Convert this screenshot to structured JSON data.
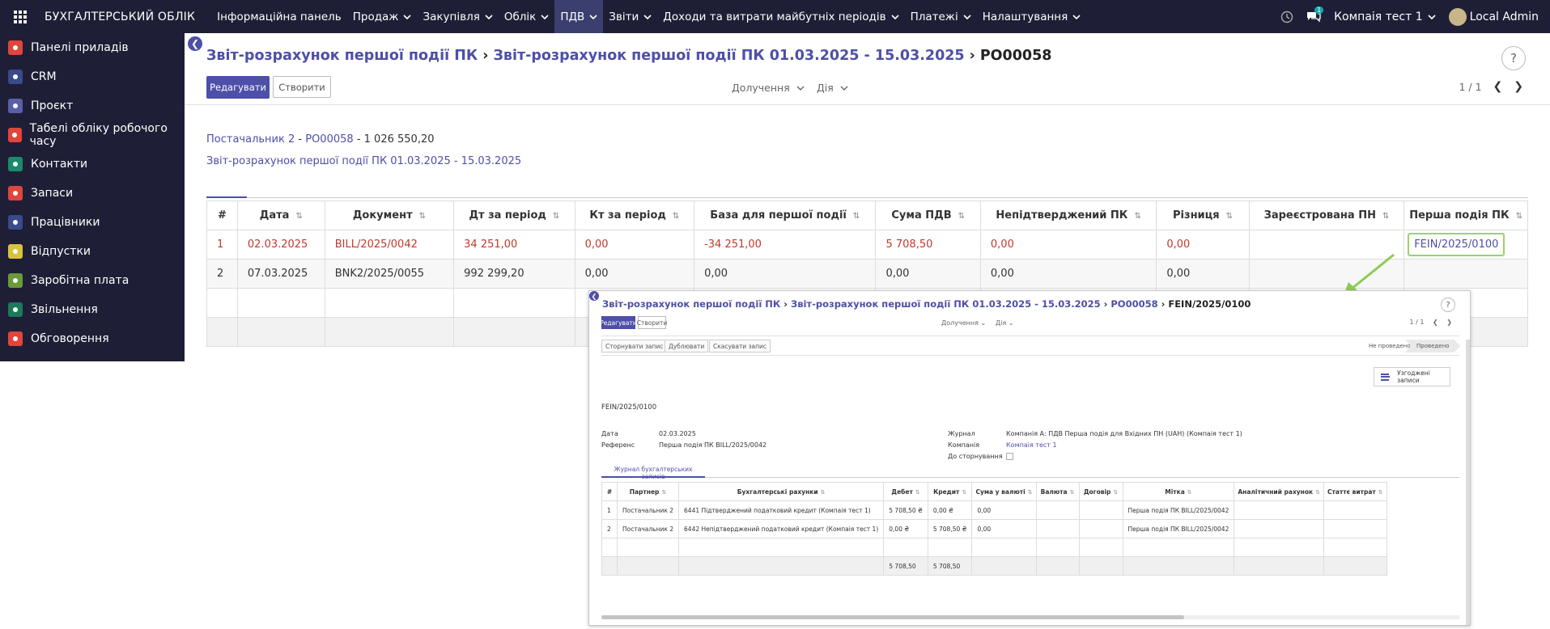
{
  "topbar": {
    "brand": "БУХГАЛТЕРСЬКИЙ ОБЛІК",
    "menu": [
      {
        "label": "Інформаційна панель",
        "caret": false,
        "active": false
      },
      {
        "label": "Продаж",
        "caret": true,
        "active": false
      },
      {
        "label": "Закупівля",
        "caret": true,
        "active": false
      },
      {
        "label": "Облік",
        "caret": true,
        "active": false
      },
      {
        "label": "ПДВ",
        "caret": true,
        "active": true
      },
      {
        "label": "Звіти",
        "caret": true,
        "active": false
      },
      {
        "label": "Доходи та витрати майбутніх періодів",
        "caret": true,
        "active": false
      },
      {
        "label": "Платежі",
        "caret": true,
        "active": false
      },
      {
        "label": "Налаштування",
        "caret": true,
        "active": false
      }
    ],
    "company": "Компаія тест 1",
    "user": "Local Admin",
    "chat_badge": "1"
  },
  "sidebar": {
    "items": [
      {
        "label": "Панелі приладів",
        "icon": "dashboard-icon",
        "color": "#e0463b"
      },
      {
        "label": "CRM",
        "icon": "crm-icon",
        "color": "#3a4a8a"
      },
      {
        "label": "Проєкт",
        "icon": "project-icon",
        "color": "#5a5ea8"
      },
      {
        "label": "Табелі обліку робочого часу",
        "icon": "timesheet-icon",
        "color": "#e0463b"
      },
      {
        "label": "Контакти",
        "icon": "contacts-icon",
        "color": "#1a8a6a"
      },
      {
        "label": "Запаси",
        "icon": "inventory-icon",
        "color": "#e0463b"
      },
      {
        "label": "Працівники",
        "icon": "employees-icon",
        "color": "#3a4a8a"
      },
      {
        "label": "Відпустки",
        "icon": "time-off-icon",
        "color": "#d8c43a"
      },
      {
        "label": "Заробітна плата",
        "icon": "payroll-icon",
        "color": "#6a9a3a"
      },
      {
        "label": "Звільнення",
        "icon": "resignation-icon",
        "color": "#1a7a5a"
      },
      {
        "label": "Обговорення",
        "icon": "discuss-icon",
        "color": "#e0463b"
      }
    ]
  },
  "main": {
    "breadcrumbs": [
      "Звіт-розрахунок першої події ПК",
      "Звіт-розрахунок першої події ПК 01.03.2025 - 15.03.2025",
      "PO00058"
    ],
    "edit_label": "Редагувати",
    "create_label": "Створити",
    "attachments_label": "Долучення",
    "action_label": "Дія",
    "pager": "1 / 1",
    "info": {
      "partner": "Постачальник 2",
      "sep": "-",
      "order": "PO00058",
      "amount": "1 026 550,20",
      "report": "Звіт-розрахунок першої події ПК 01.03.2025 - 15.03.2025"
    },
    "table": {
      "headers": [
        "#",
        "Дата",
        "Документ",
        "Дт за період",
        "Кт за період",
        "База для першої події",
        "Сума ПДВ",
        "Непідтверджений ПК",
        "Різниця",
        "Зареєстрована ПН",
        "Перша подія ПК"
      ],
      "rows": [
        [
          "1",
          "02.03.2025",
          "BILL/2025/0042",
          "34 251,00",
          "0,00",
          "-34 251,00",
          "5 708,50",
          "0,00",
          "0,00",
          "",
          "FEIN/2025/0100"
        ],
        [
          "2",
          "07.03.2025",
          "BNK2/2025/0055",
          "992 299,20",
          "0,00",
          "0,00",
          "0,00",
          "0,00",
          "0,00",
          "",
          ""
        ]
      ]
    }
  },
  "inset": {
    "breadcrumbs": [
      "Звіт-розрахунок першої події ПК",
      "Звіт-розрахунок першої події ПК 01.03.2025 - 15.03.2025",
      "PO00058",
      "FEIN/2025/0100"
    ],
    "edit_label": "Редагувати",
    "create_label": "Створити",
    "attachments_label": "Долучення",
    "action_label": "Дія",
    "pager": "1 / 1",
    "buttons": [
      "Сторнувати запис",
      "Дублювати",
      "Скасувати запис"
    ],
    "states": [
      "Не проведено",
      "Проведено"
    ],
    "reconciled_label": "Узгоджені записи",
    "name": "FEIN/2025/0100",
    "fields": {
      "date_label": "Дата",
      "date": "02.03.2025",
      "ref_label": "Референс",
      "ref": "Перша подія ПК BILL/2025/0042",
      "journal_label": "Журнал",
      "journal": "Компанія А: ПДВ Перша подія для Вхідних ПН (UAH) (Компаія тест 1)",
      "company_label": "Компанія",
      "company": "Компаія тест 1",
      "reverse_label": "До сторнування"
    },
    "tab_label": "Журнал бухгалтерських записів",
    "table": {
      "headers": [
        "#",
        "Партнер",
        "Бухгалтерські рахунки",
        "Дебет",
        "Кредит",
        "Сума у валюті",
        "Валюта",
        "Договір",
        "Мітка",
        "Аналітичний рахунок",
        "Статтє витрат"
      ],
      "rows": [
        [
          "1",
          "Постачальник 2",
          "6441 Підтверджений податковий кредит (Компаія тест 1)",
          "5 708,50 ₴",
          "0,00 ₴",
          "0,00",
          "",
          "",
          "Перша подія ПК BILL/2025/0042",
          "",
          ""
        ],
        [
          "2",
          "Постачальник 2",
          "6442 Непідтверджений податковий кредит (Компаія тест 1)",
          "0,00 ₴",
          "5 708,50 ₴",
          "0,00",
          "",
          "",
          "Перша подія ПК BILL/2025/0042",
          "",
          ""
        ]
      ],
      "totals": {
        "debit": "5 708,50",
        "credit": "5 708,50"
      }
    }
  }
}
